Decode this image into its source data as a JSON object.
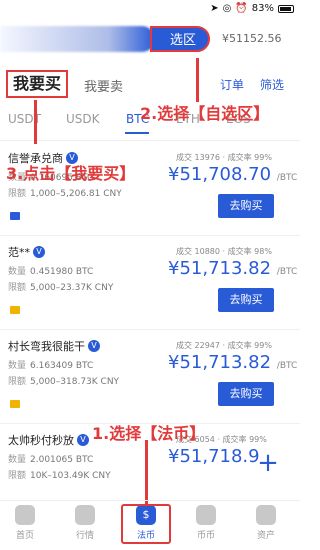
{
  "status": {
    "battery": "83%",
    "icons": [
      "location-icon",
      "compass-icon",
      "alarm-icon"
    ]
  },
  "header": {
    "zone_label": "选区",
    "top_price": "¥51152.56"
  },
  "tabs": {
    "buy": "我要买",
    "sell": "我要卖",
    "orders": "订单",
    "filter": "筛选"
  },
  "coins": [
    {
      "label": "USDT",
      "active": false
    },
    {
      "label": "USDK",
      "active": false
    },
    {
      "label": "BTC",
      "active": true
    },
    {
      "label": "ETH",
      "active": false
    },
    {
      "label": "EOS",
      "active": false
    }
  ],
  "listings": [
    {
      "seller": "信誉承兑商",
      "stats": "成交 13976 · 成交率 99%",
      "qty_label": "数量",
      "qty": "0.160695 BTC",
      "limit_label": "限额",
      "limit": "1,000–5,206.81 CNY",
      "price": "¥51,708.70",
      "unit": "/BTC",
      "button": "去购买"
    },
    {
      "seller": "范**",
      "stats": "成交 10880 · 成交率 98%",
      "qty_label": "数量",
      "qty": "0.451980 BTC",
      "limit_label": "限额",
      "limit": "5,000–23.37K CNY",
      "price": "¥51,713.82",
      "unit": "/BTC",
      "button": "去购买"
    },
    {
      "seller": "村长弯我很能干",
      "stats": "成交 22947 · 成交率 99%",
      "qty_label": "数量",
      "qty": "6.163409 BTC",
      "limit_label": "限额",
      "limit": "5,000–318.73K CNY",
      "price": "¥51,713.82",
      "unit": "/BTC",
      "button": "去购买"
    },
    {
      "seller": "太帅秒付秒放",
      "stats": "成交 6054 · 成交率 99%",
      "qty_label": "数量",
      "qty": "2.001065 BTC",
      "limit_label": "限额",
      "limit": "10K–103.49K CNY",
      "price": "¥51,718.9",
      "unit": "",
      "button": ""
    }
  ],
  "annotations": {
    "step1": "1.选择【法币】",
    "step2": "2.选择【自选区】",
    "step3": "3.点击【我要买】"
  },
  "nav": [
    {
      "label": "首页",
      "icon": "home-icon",
      "active": false
    },
    {
      "label": "行情",
      "icon": "market-icon",
      "active": false
    },
    {
      "label": "法币",
      "icon": "fiat-icon",
      "active": true
    },
    {
      "label": "币币",
      "icon": "coin-icon",
      "active": false
    },
    {
      "label": "资产",
      "icon": "wallet-icon",
      "active": false
    }
  ],
  "colors": {
    "accent": "#2a5bd7",
    "annotation": "#e23a3a"
  }
}
